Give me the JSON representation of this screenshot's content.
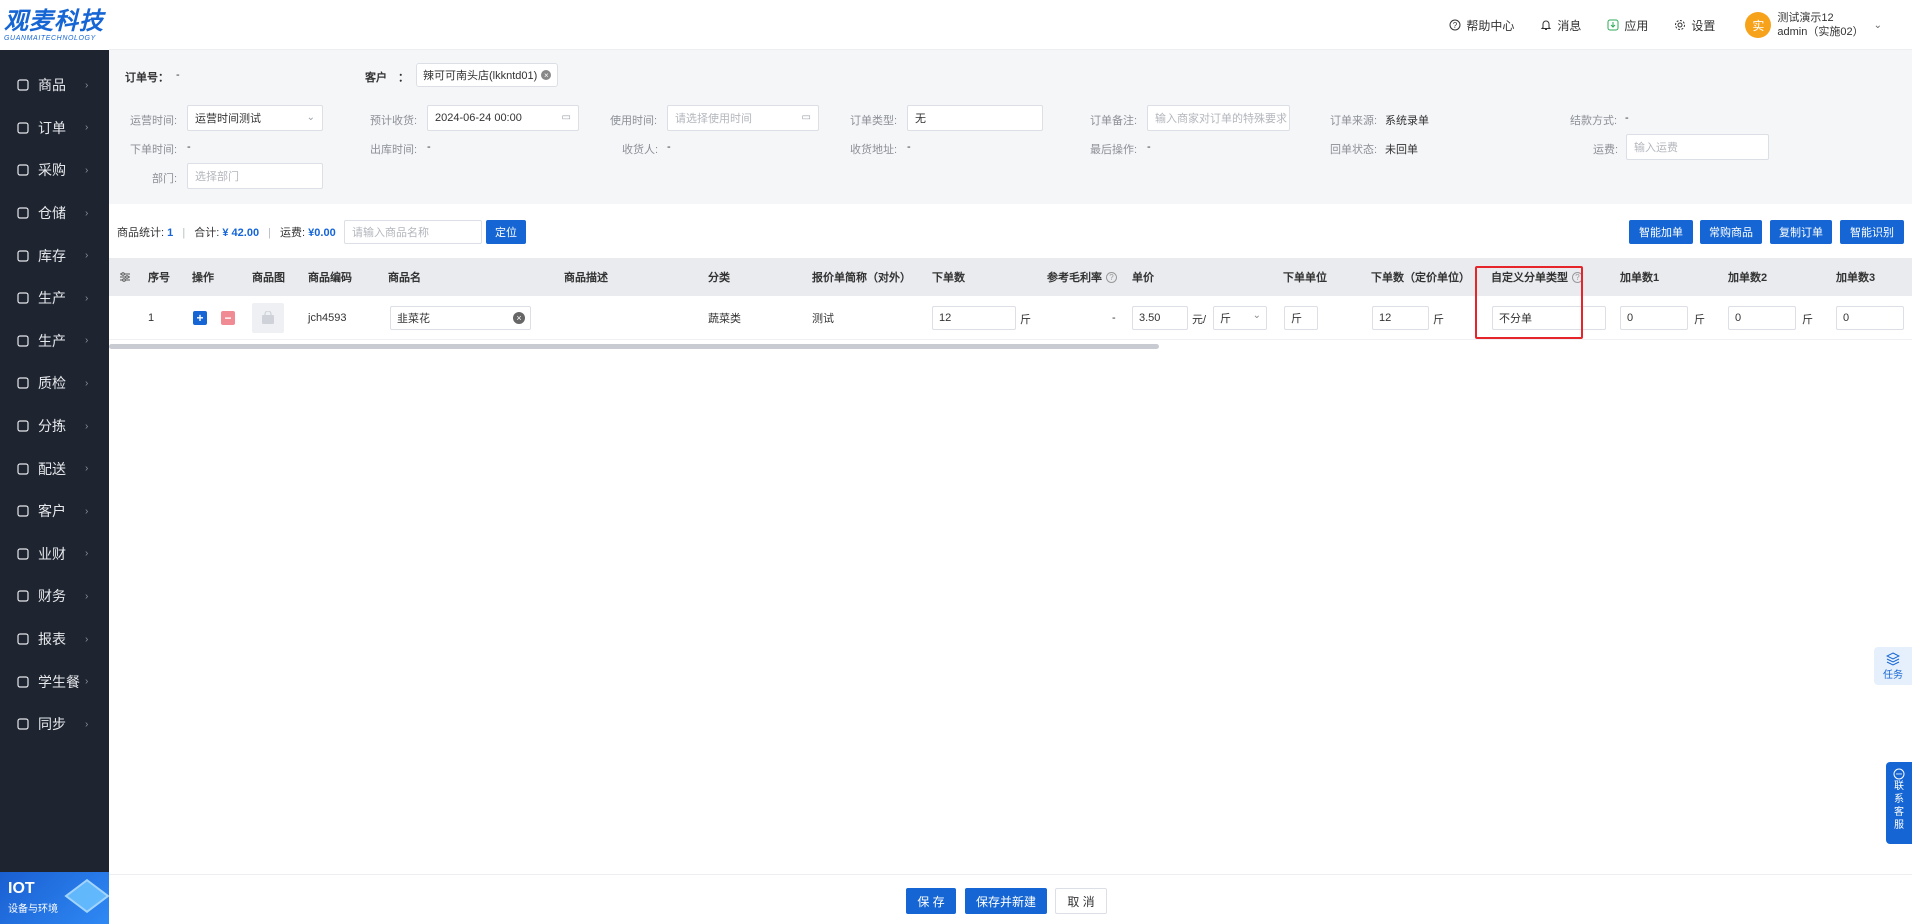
{
  "brand": {
    "name": "观麦科技",
    "sub": "GUANMAITECHNOLOGY"
  },
  "sidebar": {
    "items": [
      {
        "label": "商品",
        "icon": "grid-icon"
      },
      {
        "label": "订单",
        "icon": "clipboard-icon"
      },
      {
        "label": "采购",
        "icon": "bag-icon"
      },
      {
        "label": "仓储",
        "icon": "warehouse-icon"
      },
      {
        "label": "库存",
        "icon": "inventory-icon"
      },
      {
        "label": "生产",
        "icon": "factory-icon"
      },
      {
        "label": "生产",
        "icon": "factory-icon"
      },
      {
        "label": "质检",
        "icon": "shield-check-icon"
      },
      {
        "label": "分拣",
        "icon": "sort-icon"
      },
      {
        "label": "配送",
        "icon": "truck-icon"
      },
      {
        "label": "客户",
        "icon": "users-icon"
      },
      {
        "label": "业财",
        "icon": "bar-chart-icon"
      },
      {
        "label": "财务",
        "icon": "wallet-icon"
      },
      {
        "label": "报表",
        "icon": "pie-chart-icon"
      },
      {
        "label": "学生餐",
        "icon": "meal-icon"
      },
      {
        "label": "同步",
        "icon": "sync-icon"
      }
    ],
    "iot": {
      "title": "IOT",
      "subtitle": "设备与环境"
    }
  },
  "header": {
    "help": "帮助中心",
    "messages": "消息",
    "apps": "应用",
    "settings": "设置",
    "user": {
      "avatar": "实",
      "name": "测试演示12",
      "account": "admin（实施02）"
    }
  },
  "form": {
    "order_no_label": "订单号：",
    "order_no_value": "-",
    "customer_label": "客户　：",
    "customer_value": "辣可可南头店(lkkntd01)",
    "op_time_label": "运营时间:",
    "op_time_value": "运营时间测试",
    "expected_label": "预计收货:",
    "expected_value": "2024-06-24 00:00",
    "use_time_label": "使用时间:",
    "use_time_placeholder": "请选择使用时间",
    "order_type_label": "订单类型:",
    "order_type_value": "无",
    "remark_label": "订单备注:",
    "remark_placeholder": "输入商家对订单的特殊要求",
    "source_label": "订单来源:",
    "source_value": "系统录单",
    "settle_label": "结款方式:",
    "settle_value": "-",
    "order_time_label": "下单时间:",
    "order_time_value": "-",
    "outbound_label": "出库时间:",
    "outbound_value": "-",
    "receiver_label": "收货人:",
    "receiver_value": "-",
    "address_label": "收货地址:",
    "address_value": "-",
    "last_op_label": "最后操作:",
    "last_op_value": "-",
    "return_label": "回单状态:",
    "return_value": "未回单",
    "freight_label": "运费:",
    "freight_placeholder": "输入运费",
    "dept_label": "部门:",
    "dept_placeholder": "选择部门"
  },
  "toolbar": {
    "count_label": "商品统计:",
    "count_value": "1",
    "total_label": "合计:",
    "total_value": "¥ 42.00",
    "freight_label": "运费:",
    "freight_value": "¥0.00",
    "search_placeholder": "请输入商品名称",
    "locate": "定位",
    "smart_add": "智能加单",
    "frequent": "常购商品",
    "copy_order": "复制订单",
    "smart_recognize": "智能识别"
  },
  "table": {
    "headers": {
      "seq": "序号",
      "ops": "操作",
      "image": "商品图",
      "code": "商品编码",
      "name": "商品名",
      "desc": "商品描述",
      "category": "分类",
      "quote_alias": "报价单简称（对外）",
      "qty": "下单数",
      "margin": "参考毛利率",
      "price": "单价",
      "order_unit": "下单单位",
      "qty_pricing": "下单数（定价单位）",
      "split_type": "自定义分单类型",
      "add1": "加单数1",
      "add2": "加单数2",
      "add3": "加单数3"
    },
    "row": {
      "seq": "1",
      "code": "jch4593",
      "name": "韭菜花",
      "category": "蔬菜类",
      "quote_alias": "测试",
      "qty": "12",
      "qty_unit": "斤",
      "margin": "-",
      "price": "3.50",
      "price_unit": "元/",
      "price_unit_select": "斤",
      "order_unit": "斤",
      "qty_pricing": "12",
      "qty_pricing_unit": "斤",
      "split_type": "不分单",
      "add1": "0",
      "add1_unit": "斤",
      "add2": "0",
      "add2_unit": "斤",
      "add3": "0"
    }
  },
  "float": {
    "task": "任务",
    "cs": [
      "联",
      "系",
      "客",
      "服"
    ]
  },
  "footer": {
    "save": "保 存",
    "save_new": "保存并新建",
    "cancel": "取 消"
  }
}
